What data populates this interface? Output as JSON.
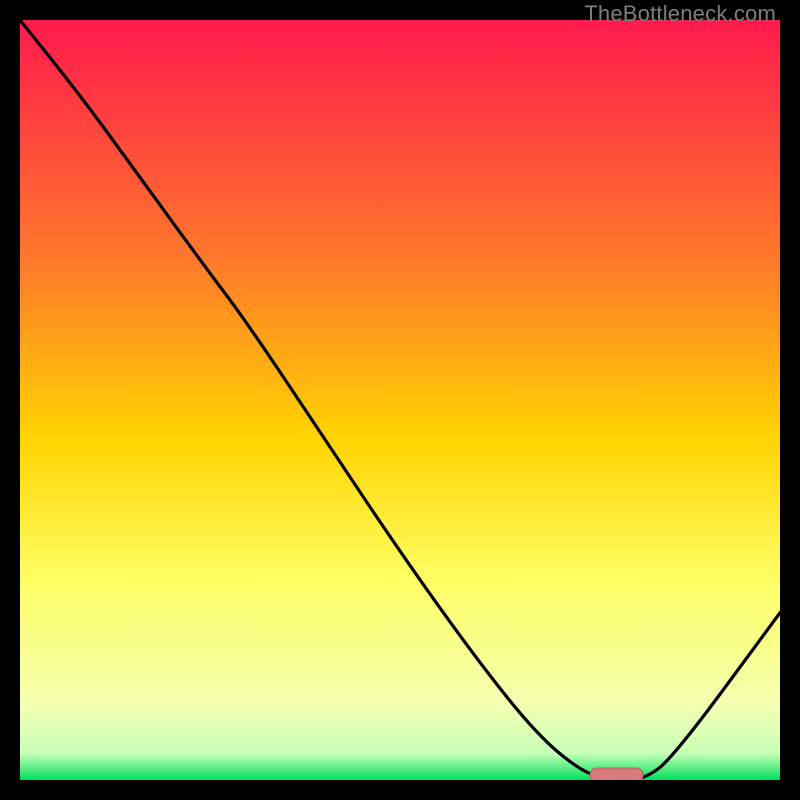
{
  "watermark": "TheBottleneck.com",
  "colors": {
    "gradient_top": "#ff1a4d",
    "gradient_mid1": "#ff7a2a",
    "gradient_mid2": "#ffd400",
    "gradient_mid3": "#ffff66",
    "gradient_mid4": "#f4ffb0",
    "gradient_bottom": "#00e05a",
    "curve": "#000000",
    "marker_fill": "#d97a7e",
    "marker_stroke": "#b85b60"
  },
  "chart_data": {
    "type": "line",
    "title": "",
    "xlabel": "",
    "ylabel": "",
    "xlim": [
      0,
      100
    ],
    "ylim": [
      0,
      100
    ],
    "series": [
      {
        "name": "bottleneck-curve",
        "x": [
          0,
          8,
          16,
          24,
          30,
          40,
          50,
          60,
          68,
          74,
          78,
          82,
          86,
          100
        ],
        "y": [
          100,
          90,
          79,
          68,
          60,
          45,
          30,
          16,
          6,
          1,
          0,
          0,
          3,
          22
        ]
      }
    ],
    "markers": [
      {
        "name": "optimal-range",
        "x_start": 75,
        "x_end": 82,
        "y": 0
      }
    ],
    "gradient_stops_pct": [
      0,
      32,
      55,
      74,
      90,
      96.5,
      100
    ]
  }
}
